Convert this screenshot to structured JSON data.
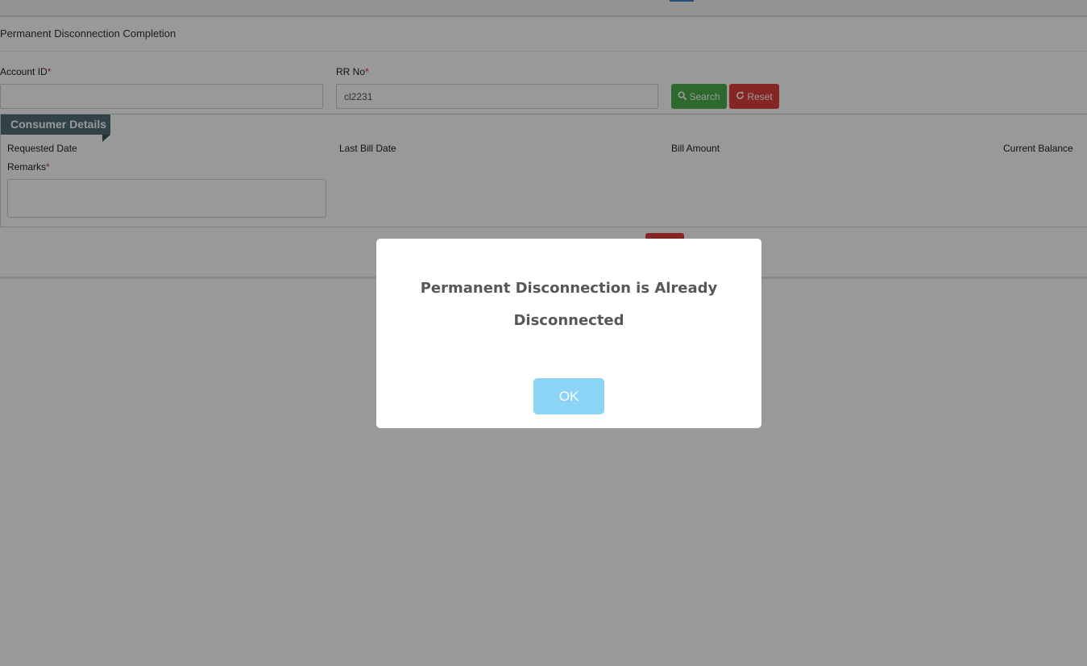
{
  "page": {
    "panel_title": "Permanent Disconnection Completion"
  },
  "search_form": {
    "account_id_label": "Account ID",
    "rr_no_label": "RR No",
    "required_mark": "*",
    "account_id_value": "",
    "rr_no_value": "cl2231",
    "search_label": "Search",
    "reset_label": "Reset"
  },
  "consumer_details": {
    "legend": "Consumer Details",
    "requested_date_label": "Requested Date",
    "last_bill_date_label": "Last Bill Date",
    "bill_amount_label": "Bill Amount",
    "current_balance_label": "Current Balance",
    "remarks_label": "Remarks",
    "remarks_value": ""
  },
  "modal": {
    "message": "Permanent Disconnection is Already Disconnected",
    "ok_label": "OK"
  },
  "icons": {
    "search": "search-icon",
    "reset": "refresh-icon"
  },
  "colors": {
    "search_button": "#4cae4c",
    "reset_button": "#e0403c",
    "legend_tab": "#546e7a",
    "ok_button": "#8cd4f5",
    "required": "#d9302c"
  }
}
